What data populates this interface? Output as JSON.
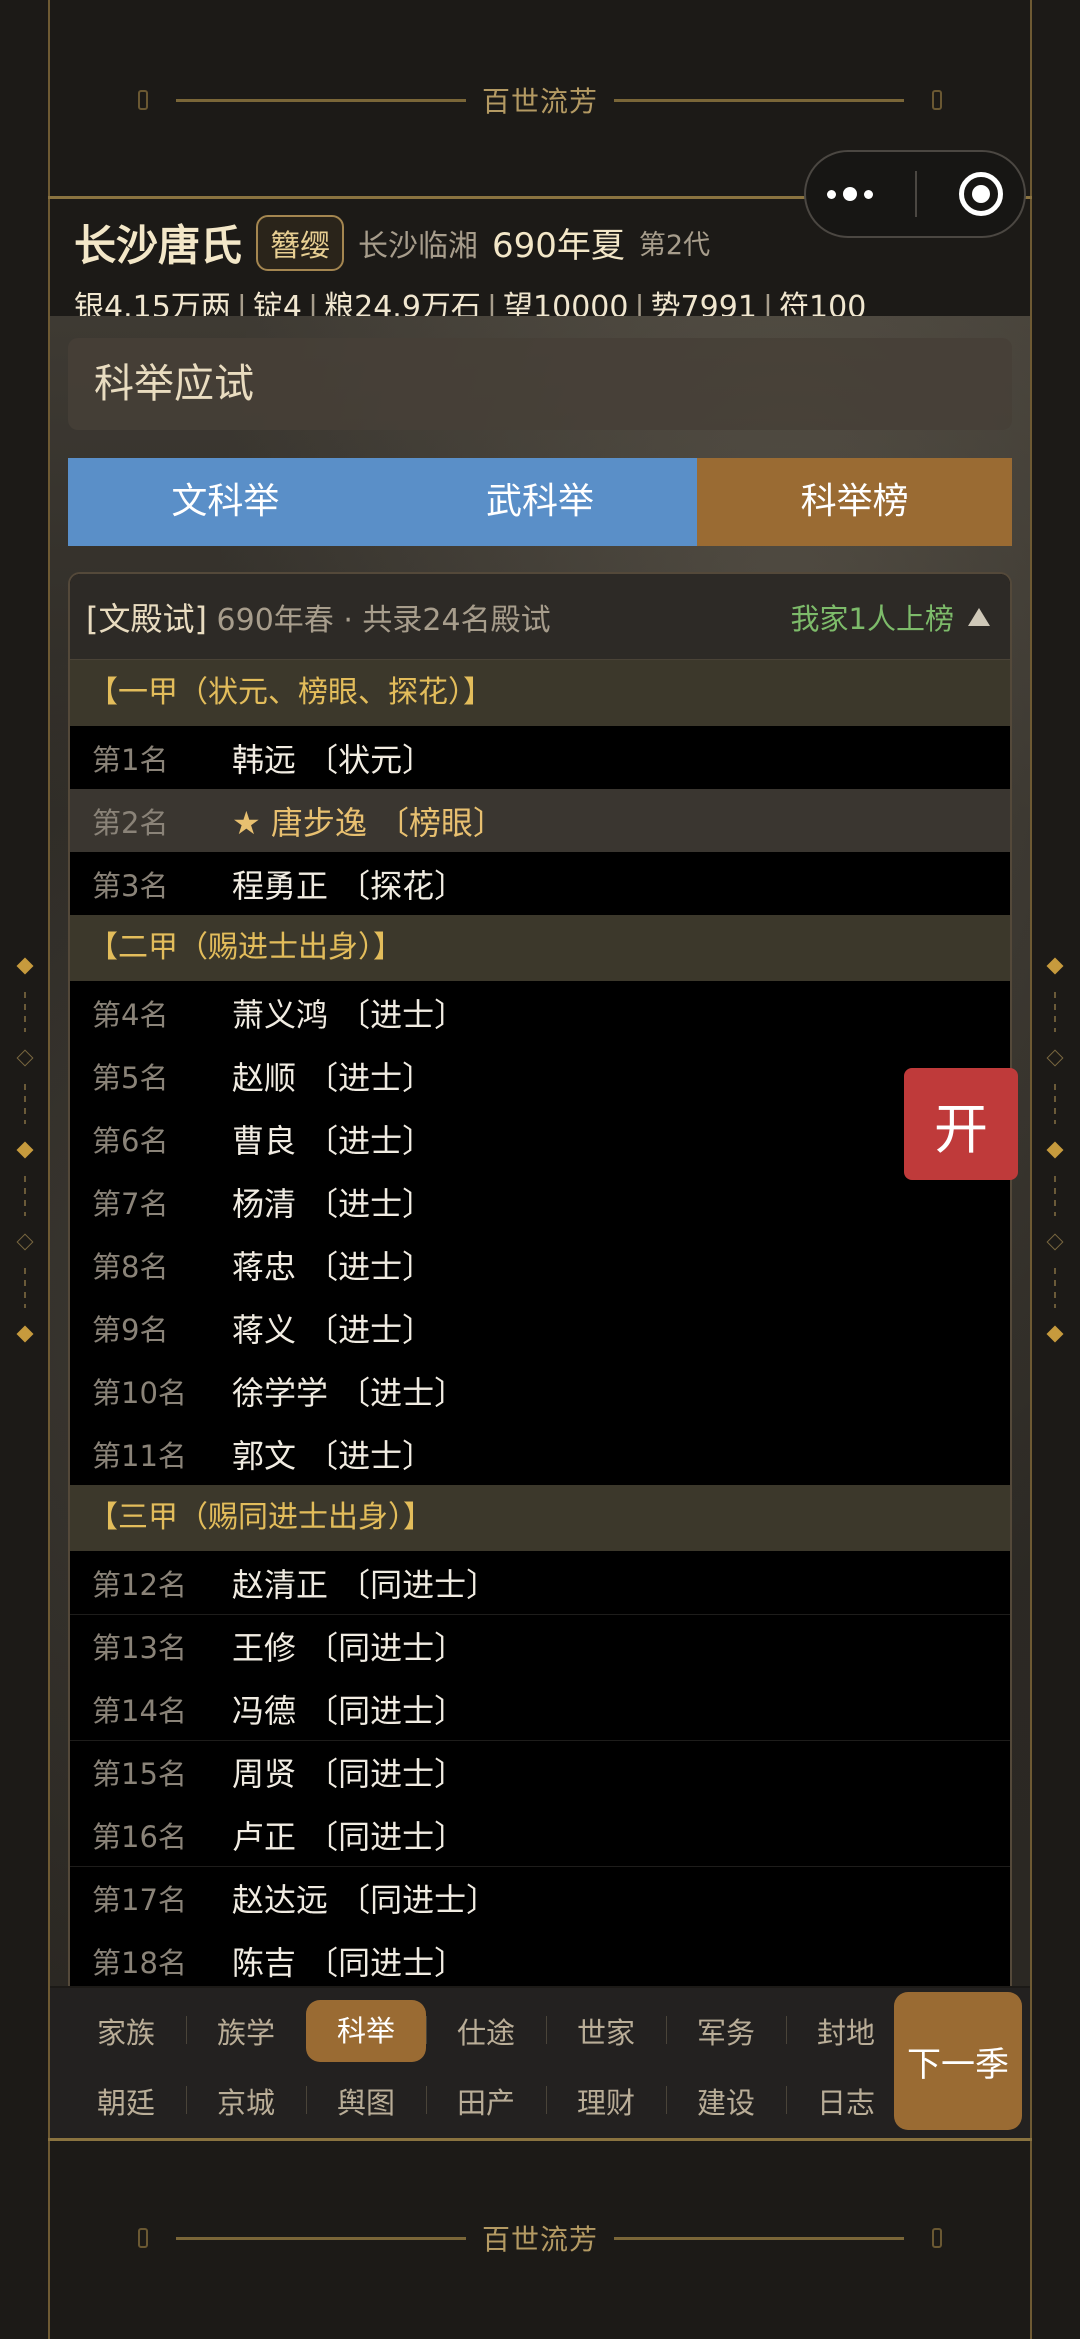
{
  "banner_text": "百世流芳",
  "header": {
    "family_name": "长沙唐氏",
    "title_badge": "簪缨",
    "place": "长沙临湘",
    "year": "690年夏",
    "generation": "第2代",
    "resources": [
      "银4.15万两",
      "锭4",
      "粮24.9万石",
      "望10000",
      "势7991",
      "符100"
    ]
  },
  "section_title": "科举应试",
  "tabs": [
    {
      "label": "文科举",
      "active": false
    },
    {
      "label": "武科举",
      "active": false
    },
    {
      "label": "科举榜",
      "active": true
    }
  ],
  "list_head": {
    "exam": "[文殿试]",
    "info": "690年春 · 共录24名殿试",
    "family_count": "我家1人上榜"
  },
  "groups": [
    {
      "title": "【一甲（状元、榜眼、探花）】",
      "rows": [
        {
          "rank": "第1名",
          "name": "韩远  〔状元〕",
          "highlight": false
        },
        {
          "rank": "第2名",
          "name": "★ 唐步逸  〔榜眼〕",
          "highlight": true
        },
        {
          "rank": "第3名",
          "name": "程勇正  〔探花〕",
          "highlight": false
        }
      ]
    },
    {
      "title": "【二甲（赐进士出身）】",
      "rows": [
        {
          "rank": "第4名",
          "name": "萧义鸿  〔进士〕"
        },
        {
          "rank": "第5名",
          "name": "赵顺  〔进士〕"
        },
        {
          "rank": "第6名",
          "name": "曹良  〔进士〕"
        },
        {
          "rank": "第7名",
          "name": "杨清  〔进士〕"
        },
        {
          "rank": "第8名",
          "name": "蒋忠  〔进士〕"
        },
        {
          "rank": "第9名",
          "name": "蒋义  〔进士〕"
        },
        {
          "rank": "第10名",
          "name": "徐学学  〔进士〕"
        },
        {
          "rank": "第11名",
          "name": "郭文  〔进士〕"
        }
      ]
    },
    {
      "title": "【三甲（赐同进士出身）】",
      "rows": [
        {
          "rank": "第12名",
          "name": "赵清正  〔同进士〕"
        },
        {
          "rank": "第13名",
          "name": "王修  〔同进士〕"
        },
        {
          "rank": "第14名",
          "name": "冯德  〔同进士〕"
        },
        {
          "rank": "第15名",
          "name": "周贤  〔同进士〕"
        },
        {
          "rank": "第16名",
          "name": "卢正  〔同进士〕"
        },
        {
          "rank": "第17名",
          "name": "赵达远  〔同进士〕"
        },
        {
          "rank": "第18名",
          "name": "陈吉  〔同进士〕"
        }
      ]
    }
  ],
  "open_button": "开",
  "nav": {
    "row1": [
      "家族",
      "族学",
      "科举",
      "仕途",
      "世家",
      "军务",
      "封地"
    ],
    "row2": [
      "朝廷",
      "京城",
      "舆图",
      "田产",
      "理财",
      "建设",
      "日志"
    ],
    "active": "科举",
    "next_button": "下一季"
  },
  "colors": {
    "tab_blue": "#5a8fc8",
    "accent_brown": "#9a6b33",
    "open_red": "#bf3a3a",
    "group_gold": "#e3bd5b",
    "family_green": "#7dbb6a"
  }
}
